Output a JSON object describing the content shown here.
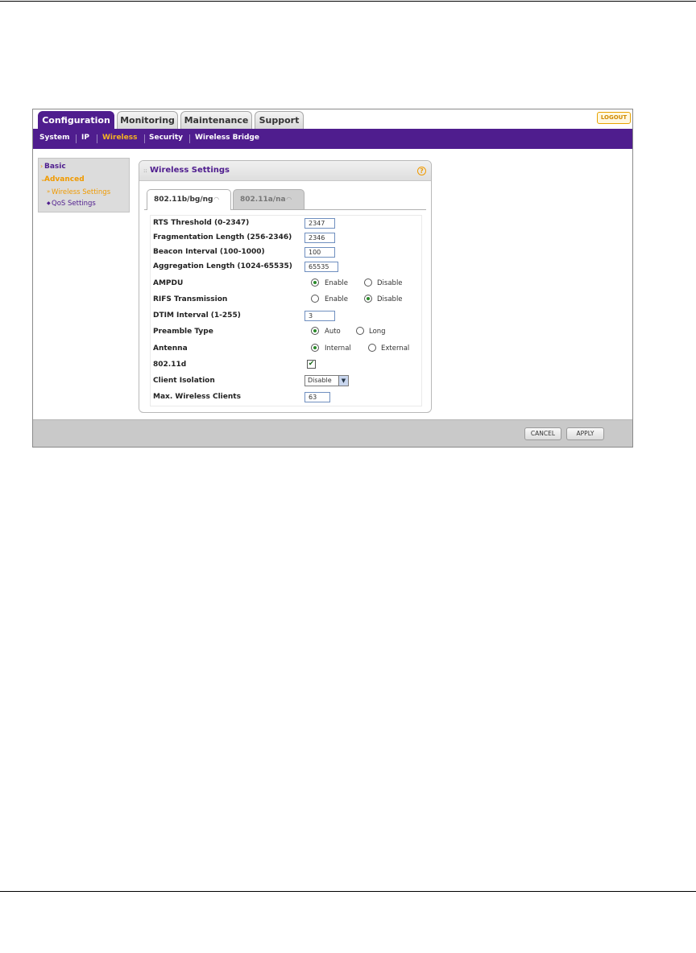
{
  "top_tabs": [
    {
      "label": "Configuration",
      "active": true
    },
    {
      "label": "Monitoring",
      "active": false
    },
    {
      "label": "Maintenance",
      "active": false
    },
    {
      "label": "Support",
      "active": false
    }
  ],
  "logout_label": "LOGOUT",
  "sub_nav": [
    {
      "label": "System",
      "active": false
    },
    {
      "label": "IP",
      "active": false
    },
    {
      "label": "Wireless",
      "active": true
    },
    {
      "label": "Security",
      "active": false
    },
    {
      "label": "Wireless Bridge",
      "active": false
    }
  ],
  "left_menu": {
    "basic": "Basic",
    "advanced": "Advanced",
    "wireless_settings": "Wireless Settings",
    "qos_settings": "QoS Settings"
  },
  "panel": {
    "title": "Wireless Settings",
    "help": "?",
    "tabs": [
      {
        "label": "802.11b/bg/ng",
        "active": true
      },
      {
        "label": "802.11a/na",
        "active": false
      }
    ]
  },
  "form": {
    "rts_threshold": {
      "label": "RTS Threshold (0-2347)",
      "value": "2347"
    },
    "fragmentation_length": {
      "label": "Fragmentation Length (256-2346)",
      "value": "2346"
    },
    "beacon_interval": {
      "label": "Beacon Interval (100-1000)",
      "value": "100"
    },
    "aggregation_length": {
      "label": "Aggregation Length (1024-65535)",
      "value": "65535"
    },
    "ampdu": {
      "label": "AMPDU",
      "option1": "Enable",
      "option2": "Disable",
      "selected": "Enable"
    },
    "rifs": {
      "label": "RIFS Transmission",
      "option1": "Enable",
      "option2": "Disable",
      "selected": "Disable"
    },
    "dtim_interval": {
      "label": "DTIM Interval (1-255)",
      "value": "3"
    },
    "preamble": {
      "label": "Preamble Type",
      "option1": "Auto",
      "option2": "Long",
      "selected": "Auto"
    },
    "antenna": {
      "label": "Antenna",
      "option1": "Internal",
      "option2": "External",
      "selected": "Internal"
    },
    "dot11d": {
      "label": "802.11d",
      "checked": true,
      "check_glyph": "✔"
    },
    "client_isolation": {
      "label": "Client Isolation",
      "value": "Disable",
      "arrow": "▼"
    },
    "max_clients": {
      "label": "Max. Wireless Clients",
      "value": "63"
    }
  },
  "buttons": {
    "cancel": "CANCEL",
    "apply": "APPLY"
  },
  "colors": {
    "brand_purple": "#4f1d8e",
    "accent_orange": "#f09a00"
  },
  "icons": {
    "wifi": "wifi-icon",
    "help": "help-icon",
    "menu_arrow": "chevron-right-icon"
  }
}
